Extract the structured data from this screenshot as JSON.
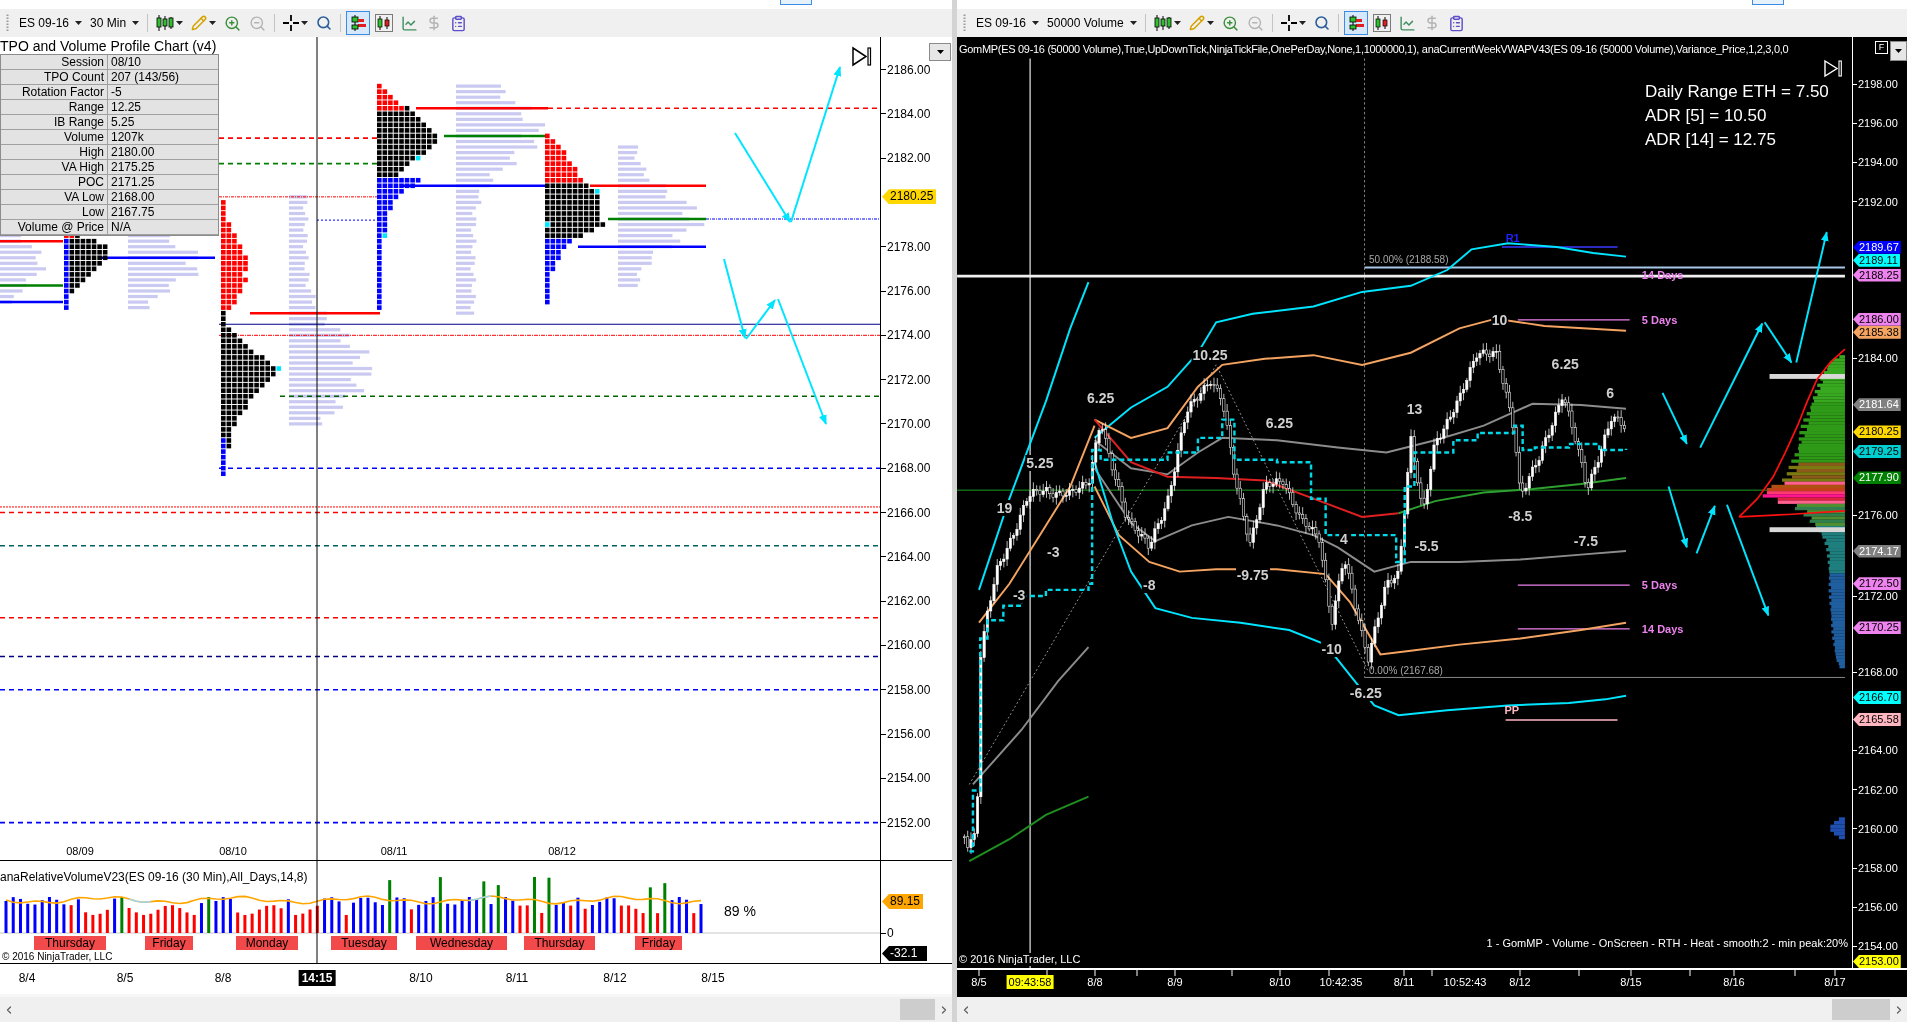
{
  "left_window": {
    "toolbar": {
      "instrument": "ES 09-16",
      "interval": "30 Min",
      "tools": [
        {
          "kind": "style",
          "selected": false,
          "disabled": false
        },
        {
          "kind": "draw",
          "selected": false,
          "disabled": false
        },
        {
          "kind": "zoomin",
          "selected": false,
          "disabled": false
        },
        {
          "kind": "zoomout",
          "selected": false,
          "disabled": true
        },
        {
          "kind": "crosshair",
          "selected": false,
          "disabled": false
        },
        {
          "kind": "magnify",
          "selected": false,
          "disabled": false
        },
        {
          "kind": "markers",
          "selected": true,
          "disabled": false
        },
        {
          "kind": "tradeview",
          "selected": false,
          "disabled": false
        },
        {
          "kind": "data",
          "selected": false,
          "disabled": false
        },
        {
          "kind": "dollar",
          "selected": false,
          "disabled": true
        },
        {
          "kind": "properties",
          "selected": false,
          "disabled": false
        }
      ]
    },
    "chart": {
      "title": "TPO and Volume Profile Chart (v4)",
      "stats": [
        {
          "label": "Session",
          "value": "08/10"
        },
        {
          "label": "TPO Count",
          "value": "207 (143/56)"
        },
        {
          "label": "Rotation Factor",
          "value": "-5"
        },
        {
          "label": "Range",
          "value": "12.25"
        },
        {
          "label": "IB Range",
          "value": "5.25"
        },
        {
          "label": "Volume",
          "value": "1207k"
        },
        {
          "label": "High",
          "value": "2180.00"
        },
        {
          "label": "VA High",
          "value": "2175.25"
        },
        {
          "label": "POC",
          "value": "2171.25"
        },
        {
          "label": "VA Low",
          "value": "2168.00"
        },
        {
          "label": "Low",
          "value": "2167.75"
        },
        {
          "label": "Volume @ Price",
          "value": "N/A"
        }
      ],
      "session_dates": [
        "08/09",
        "08/10",
        "08/11",
        "08/12"
      ],
      "price_ticks": [
        "2186.00",
        "2184.00",
        "2182.00",
        "2178.00",
        "2176.00",
        "2174.00",
        "2172.00",
        "2170.00",
        "2168.00",
        "2166.00",
        "2164.00",
        "2162.00",
        "2160.00",
        "2158.00",
        "2156.00",
        "2154.00",
        "2152.00"
      ],
      "price_tag": "2180.25"
    },
    "indicator": {
      "title": "anaRelativeVolumeV23(ES 09-16 (30 Min),All_Days,14,8)",
      "reading": "89 %",
      "value_tag": "89.15",
      "zero_tick": "0",
      "cursor_value": "-32.1",
      "days": [
        "Thursday",
        "Friday",
        "Monday",
        "Tuesday",
        "Wednesday",
        "Thursday",
        "Friday"
      ],
      "copyright": "© 2016 NinjaTrader, LLC"
    },
    "time_axis": [
      {
        "label": "8/4",
        "kind": "tick"
      },
      {
        "label": "8/5",
        "kind": "tick"
      },
      {
        "label": "8/8",
        "kind": "tick"
      },
      {
        "label": "14:15",
        "kind": "cursor"
      },
      {
        "label": "8/10",
        "kind": "tick"
      },
      {
        "label": "8/11",
        "kind": "tick"
      },
      {
        "label": "8/12",
        "kind": "tick"
      },
      {
        "label": "8/15",
        "kind": "tick"
      }
    ]
  },
  "right_window": {
    "toolbar": {
      "instrument": "ES 09-16",
      "interval": "50000 Volume",
      "tools": [
        {
          "kind": "style",
          "selected": false,
          "disabled": false
        },
        {
          "kind": "draw",
          "selected": false,
          "disabled": false
        },
        {
          "kind": "zoomin",
          "selected": false,
          "disabled": false
        },
        {
          "kind": "zoomout",
          "selected": false,
          "disabled": true
        },
        {
          "kind": "crosshair",
          "selected": false,
          "disabled": false
        },
        {
          "kind": "magnify",
          "selected": false,
          "disabled": false
        },
        {
          "kind": "markers",
          "selected": true,
          "disabled": false
        },
        {
          "kind": "tradeview",
          "selected": false,
          "disabled": false
        },
        {
          "kind": "data",
          "selected": false,
          "disabled": false
        },
        {
          "kind": "dollar",
          "selected": false,
          "disabled": true
        },
        {
          "kind": "properties",
          "selected": false,
          "disabled": false
        }
      ]
    },
    "chart": {
      "indicators": "GomMP(ES 09-16 (50000 Volume),True,UpDownTick,NinjaTickFile,OnePerDay,None,1,1000000,1), anaCurrentWeekVWAPV43(ES 09-16 (50000 Volume),Variance_Price,1,2,3,0,0",
      "corner_button": "F",
      "range_stats": [
        "Daily Range ETH = 7.50",
        "ADR [5] = 10.50",
        "ADR [14] = 12.75"
      ],
      "swing_labels": [
        "19",
        "5.25",
        "6.25",
        "10.25",
        "6.25",
        "-3",
        "-3",
        "-8",
        "-9.75",
        "4",
        "-10",
        "-6.25",
        "13",
        "-5.5",
        "10",
        "6.25",
        "6",
        "-8.5",
        "-7.5"
      ],
      "fib_labels": [
        "50.00% (2188.58)",
        "0.00% (2167.68)"
      ],
      "level_labels": [
        {
          "text": "R1",
          "color": "#2020ff"
        },
        {
          "text": "14 Days",
          "color": "#ee82ee"
        },
        {
          "text": "5 Days",
          "color": "#ee82ee"
        },
        {
          "text": "5 Days",
          "color": "#ee82ee"
        },
        {
          "text": "14 Days",
          "color": "#ee82ee"
        },
        {
          "text": "PP",
          "color": "#ffb6c1"
        }
      ],
      "price_ticks": [
        "2198.00",
        "2196.00",
        "2194.00",
        "2192.00",
        "2184.00",
        "2176.00",
        "2172.00",
        "2168.00",
        "2164.00",
        "2162.00",
        "2160.00",
        "2158.00",
        "2156.00",
        "2154.00"
      ],
      "price_tags": [
        {
          "value": "2189.67",
          "color": "#0000ff"
        },
        {
          "value": "2189.11",
          "color": "#00ffff"
        },
        {
          "value": "2188.25",
          "color": "#ee82ee"
        },
        {
          "value": "2186.00",
          "color": "#ee82ee"
        },
        {
          "value": "2185.38",
          "color": "#f4a460"
        },
        {
          "value": "2181.64",
          "color": "#808080"
        },
        {
          "value": "2180.25",
          "color": "#ffd700"
        },
        {
          "value": "2179.25",
          "color": "#00ced1"
        },
        {
          "value": "2177.90",
          "color": "#008000"
        },
        {
          "value": "2174.17",
          "color": "#808080"
        },
        {
          "value": "2172.50",
          "color": "#ee82ee"
        },
        {
          "value": "2170.25",
          "color": "#ee82ee"
        },
        {
          "value": "2166.70",
          "color": "#00ffff"
        },
        {
          "value": "2165.58",
          "color": "#ffb6c1"
        },
        {
          "value": "2153.00",
          "color": "#ffff00"
        }
      ],
      "profile_legend": "1 - GomMP - Volume - OnScreen - RTH - Heat - smooth:2 - min peak:20%",
      "copyright": "© 2016 NinjaTrader, LLC"
    },
    "time_axis": [
      {
        "label": "8/5",
        "kind": "tick"
      },
      {
        "label": "09:43:58",
        "kind": "cursor"
      },
      {
        "label": "8/8",
        "kind": "tick"
      },
      {
        "label": "8/9",
        "kind": "tick"
      },
      {
        "label": "8/10",
        "kind": "tick"
      },
      {
        "label": "10:42:35",
        "kind": "tick"
      },
      {
        "label": "8/11",
        "kind": "tick"
      },
      {
        "label": "10:52:43",
        "kind": "tick"
      },
      {
        "label": "8/12",
        "kind": "tick"
      },
      {
        "label": "8/15",
        "kind": "tick"
      },
      {
        "label": "8/16",
        "kind": "tick"
      },
      {
        "label": "8/17",
        "kind": "tick"
      }
    ]
  }
}
